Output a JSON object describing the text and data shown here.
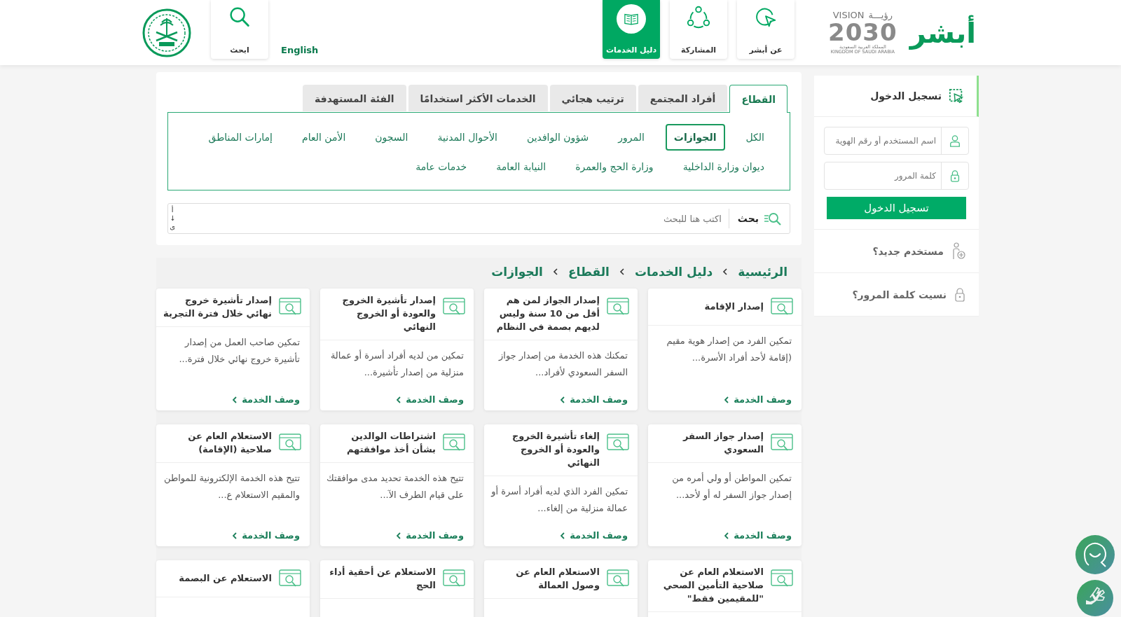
{
  "header": {
    "logo_text": "أبشر",
    "vision_logo": {
      "word": "VISION",
      "arabic_word": "رؤيـــة",
      "year": "2030",
      "country_ar": "المملكة العربية السعودية",
      "country_en": "KINGDOM OF SAUDI ARABIA"
    },
    "nav": [
      {
        "label": "عن أبشر",
        "kind": "about",
        "selected": false
      },
      {
        "label": "المشاركة",
        "kind": "share",
        "selected": false
      },
      {
        "label": "دليل الخدمات",
        "kind": "guide",
        "selected": true
      }
    ],
    "language": "English",
    "search_label": "ابحث"
  },
  "filter": {
    "tabs": [
      {
        "label": "القطاع",
        "selected": true
      },
      {
        "label": "أفراد المجتمع",
        "selected": false
      },
      {
        "label": "ترتيب هجائي",
        "selected": false
      },
      {
        "label": "الخدمات الأكثر استخدامًا",
        "selected": false
      },
      {
        "label": "الفئة المستهدفة",
        "selected": false
      }
    ],
    "category_rows": [
      [
        {
          "label": "الكل",
          "selected": false
        },
        {
          "label": "الجوازات",
          "selected": true
        },
        {
          "label": "المرور",
          "selected": false
        },
        {
          "label": "شؤون الوافدين",
          "selected": false
        },
        {
          "label": "الأحوال المدنية",
          "selected": false
        },
        {
          "label": "السجون",
          "selected": false
        },
        {
          "label": "الأمن العام",
          "selected": false
        },
        {
          "label": "إمارات المناطق",
          "selected": false
        }
      ],
      [
        {
          "label": "ديوان وزارة الداخلية",
          "selected": false
        },
        {
          "label": "وزارة الحج والعمرة",
          "selected": false
        },
        {
          "label": "النيابة العامة",
          "selected": false
        },
        {
          "label": "خدمات عامة",
          "selected": false
        }
      ]
    ],
    "search": {
      "button_label": "بحث",
      "placeholder": "اكتب هنا للبحث",
      "sort_letters": [
        "أ",
        "↓",
        "ى"
      ]
    }
  },
  "breadcrumb": [
    "الرئيسية",
    "دليل الخدمات",
    "القطاع",
    "الجوازات"
  ],
  "cards": [
    {
      "title": "إصدار الإقامة",
      "description": "تمكين الفرد من إصدار هوية مقيم (إقامة لأحد أفراد الأسرة...",
      "link": "وصف الخدمة"
    },
    {
      "title": "إصدار الجواز لمن هم أقل من 10 سنة وليس لديهم بصمة في النظام",
      "description": "تمكنك هذه الخدمة من إصدار جواز السفر السعودي لأفراد...",
      "link": "وصف الخدمة"
    },
    {
      "title": "إصدار تأشيرة الخروج والعودة أو الخروج النهائي",
      "description": "تمكين من لديه أفراد أسرة أو عمالة منزلية من إصدار تأشيرة...",
      "link": "وصف الخدمة"
    },
    {
      "title": "إصدار تأشيرة خروج نهائي خلال فترة التجربة",
      "description": "تمكين صاحب العمل من إصدار تأشيرة خروج نهائي خلال فترة...",
      "link": "وصف الخدمة"
    },
    {
      "title": "إصدار جواز السفر السعودي",
      "description": "تمكين المواطن أو ولي أمره من إصدار جواز السفر له أو لأحد...",
      "link": "وصف الخدمة"
    },
    {
      "title": "إلغاء تأشيرة الخروج والعودة أو الخروج النهائي",
      "description": "تمكين الفرد الذي لديه أفراد أسرة أو عمالة منزلية من إلغاء...",
      "link": "وصف الخدمة"
    },
    {
      "title": "اشتراطات الوالدين بشأن أخذ موافقتهم",
      "description": "تتيح هذه الخدمة تحديد مدى موافقتك على قيام الطرف الآ...",
      "link": "وصف الخدمة"
    },
    {
      "title": "الاستعلام العام عن صلاحية (الإقامة)",
      "description": "تتيح هذه الخدمة الإلكترونية للمواطن والمقيم الاستعلام ع...",
      "link": "وصف الخدمة"
    },
    {
      "title": "الاستعلام العام عن صلاحية التأمين الصحي \"للمقيمين فقط\""
    },
    {
      "title": "الاستعلام العام عن وصول العمالة"
    },
    {
      "title": "الاستعلام عن أحقية أداء الحج"
    },
    {
      "title": "الاستعلام عن البصمة"
    }
  ],
  "login": {
    "title": "تسجيل الدخول",
    "username_placeholder": "اسم المستخدم أو رقم الهوية",
    "password_placeholder": "كلمة المرور",
    "button_label": "تسجيل الدخول",
    "links": [
      {
        "label": "مستخدم جديد؟",
        "kind": "new-user"
      },
      {
        "label": "نسيت كلمة المرور؟",
        "kind": "forgot"
      }
    ]
  }
}
